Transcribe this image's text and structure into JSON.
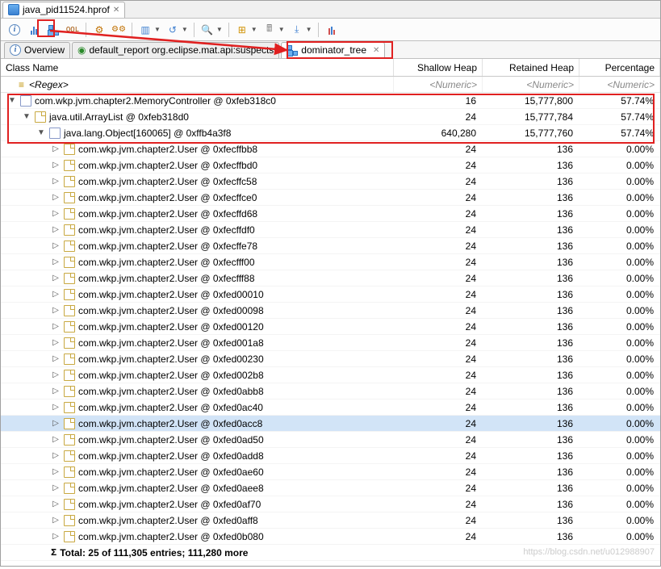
{
  "topTab": {
    "title": "java_pid11524.hprof"
  },
  "toolbar": {
    "info": "i"
  },
  "subtabs": {
    "overview": "Overview",
    "report": "default_report  org.eclipse.mat.api:suspects",
    "domtree": "dominator_tree"
  },
  "columns": {
    "name": "Class Name",
    "sh": "Shallow Heap",
    "rh": "Retained Heap",
    "pc": "Percentage"
  },
  "filters": {
    "regex": "<Regex>",
    "num": "<Numeric>"
  },
  "rows": [
    {
      "depth": 0,
      "twist": "▼",
      "icon": "cls",
      "label": "com.wkp.jvm.chapter2.MemoryController @ 0xfeb318c0",
      "sh": "16",
      "rh": "15,777,800",
      "pc": "57.74%",
      "hl": true
    },
    {
      "depth": 1,
      "twist": "▼",
      "icon": "doc",
      "label": "java.util.ArrayList @ 0xfeb318d0",
      "sh": "24",
      "rh": "15,777,784",
      "pc": "57.74%",
      "hl": true
    },
    {
      "depth": 2,
      "twist": "▼",
      "icon": "cls",
      "label": "java.lang.Object[160065] @ 0xffb4a3f8",
      "sh": "640,280",
      "rh": "15,777,760",
      "pc": "57.74%",
      "hl": true
    },
    {
      "depth": 3,
      "twist": "▷",
      "icon": "doc",
      "label": "com.wkp.jvm.chapter2.User @ 0xfecffbb8",
      "sh": "24",
      "rh": "136",
      "pc": "0.00%"
    },
    {
      "depth": 3,
      "twist": "▷",
      "icon": "doc",
      "label": "com.wkp.jvm.chapter2.User @ 0xfecffbd0",
      "sh": "24",
      "rh": "136",
      "pc": "0.00%"
    },
    {
      "depth": 3,
      "twist": "▷",
      "icon": "doc",
      "label": "com.wkp.jvm.chapter2.User @ 0xfecffc58",
      "sh": "24",
      "rh": "136",
      "pc": "0.00%"
    },
    {
      "depth": 3,
      "twist": "▷",
      "icon": "doc",
      "label": "com.wkp.jvm.chapter2.User @ 0xfecffce0",
      "sh": "24",
      "rh": "136",
      "pc": "0.00%"
    },
    {
      "depth": 3,
      "twist": "▷",
      "icon": "doc",
      "label": "com.wkp.jvm.chapter2.User @ 0xfecffd68",
      "sh": "24",
      "rh": "136",
      "pc": "0.00%"
    },
    {
      "depth": 3,
      "twist": "▷",
      "icon": "doc",
      "label": "com.wkp.jvm.chapter2.User @ 0xfecffdf0",
      "sh": "24",
      "rh": "136",
      "pc": "0.00%"
    },
    {
      "depth": 3,
      "twist": "▷",
      "icon": "doc",
      "label": "com.wkp.jvm.chapter2.User @ 0xfecffe78",
      "sh": "24",
      "rh": "136",
      "pc": "0.00%"
    },
    {
      "depth": 3,
      "twist": "▷",
      "icon": "doc",
      "label": "com.wkp.jvm.chapter2.User @ 0xfecfff00",
      "sh": "24",
      "rh": "136",
      "pc": "0.00%"
    },
    {
      "depth": 3,
      "twist": "▷",
      "icon": "doc",
      "label": "com.wkp.jvm.chapter2.User @ 0xfecfff88",
      "sh": "24",
      "rh": "136",
      "pc": "0.00%"
    },
    {
      "depth": 3,
      "twist": "▷",
      "icon": "doc",
      "label": "com.wkp.jvm.chapter2.User @ 0xfed00010",
      "sh": "24",
      "rh": "136",
      "pc": "0.00%"
    },
    {
      "depth": 3,
      "twist": "▷",
      "icon": "doc",
      "label": "com.wkp.jvm.chapter2.User @ 0xfed00098",
      "sh": "24",
      "rh": "136",
      "pc": "0.00%"
    },
    {
      "depth": 3,
      "twist": "▷",
      "icon": "doc",
      "label": "com.wkp.jvm.chapter2.User @ 0xfed00120",
      "sh": "24",
      "rh": "136",
      "pc": "0.00%"
    },
    {
      "depth": 3,
      "twist": "▷",
      "icon": "doc",
      "label": "com.wkp.jvm.chapter2.User @ 0xfed001a8",
      "sh": "24",
      "rh": "136",
      "pc": "0.00%"
    },
    {
      "depth": 3,
      "twist": "▷",
      "icon": "doc",
      "label": "com.wkp.jvm.chapter2.User @ 0xfed00230",
      "sh": "24",
      "rh": "136",
      "pc": "0.00%"
    },
    {
      "depth": 3,
      "twist": "▷",
      "icon": "doc",
      "label": "com.wkp.jvm.chapter2.User @ 0xfed002b8",
      "sh": "24",
      "rh": "136",
      "pc": "0.00%"
    },
    {
      "depth": 3,
      "twist": "▷",
      "icon": "doc",
      "label": "com.wkp.jvm.chapter2.User @ 0xfed0abb8",
      "sh": "24",
      "rh": "136",
      "pc": "0.00%"
    },
    {
      "depth": 3,
      "twist": "▷",
      "icon": "doc",
      "label": "com.wkp.jvm.chapter2.User @ 0xfed0ac40",
      "sh": "24",
      "rh": "136",
      "pc": "0.00%"
    },
    {
      "depth": 3,
      "twist": "▷",
      "icon": "doc",
      "label": "com.wkp.jvm.chapter2.User @ 0xfed0acc8",
      "sh": "24",
      "rh": "136",
      "pc": "0.00%",
      "sel": true
    },
    {
      "depth": 3,
      "twist": "▷",
      "icon": "doc",
      "label": "com.wkp.jvm.chapter2.User @ 0xfed0ad50",
      "sh": "24",
      "rh": "136",
      "pc": "0.00%"
    },
    {
      "depth": 3,
      "twist": "▷",
      "icon": "doc",
      "label": "com.wkp.jvm.chapter2.User @ 0xfed0add8",
      "sh": "24",
      "rh": "136",
      "pc": "0.00%"
    },
    {
      "depth": 3,
      "twist": "▷",
      "icon": "doc",
      "label": "com.wkp.jvm.chapter2.User @ 0xfed0ae60",
      "sh": "24",
      "rh": "136",
      "pc": "0.00%"
    },
    {
      "depth": 3,
      "twist": "▷",
      "icon": "doc",
      "label": "com.wkp.jvm.chapter2.User @ 0xfed0aee8",
      "sh": "24",
      "rh": "136",
      "pc": "0.00%"
    },
    {
      "depth": 3,
      "twist": "▷",
      "icon": "doc",
      "label": "com.wkp.jvm.chapter2.User @ 0xfed0af70",
      "sh": "24",
      "rh": "136",
      "pc": "0.00%"
    },
    {
      "depth": 3,
      "twist": "▷",
      "icon": "doc",
      "label": "com.wkp.jvm.chapter2.User @ 0xfed0aff8",
      "sh": "24",
      "rh": "136",
      "pc": "0.00%"
    },
    {
      "depth": 3,
      "twist": "▷",
      "icon": "doc",
      "label": "com.wkp.jvm.chapter2.User @ 0xfed0b080",
      "sh": "24",
      "rh": "136",
      "pc": "0.00%"
    }
  ],
  "total": {
    "sigma": "Σ",
    "label": "Total: 25 of 111,305 entries; 111,280 more"
  },
  "watermark": "https://blog.csdn.net/u012988907"
}
